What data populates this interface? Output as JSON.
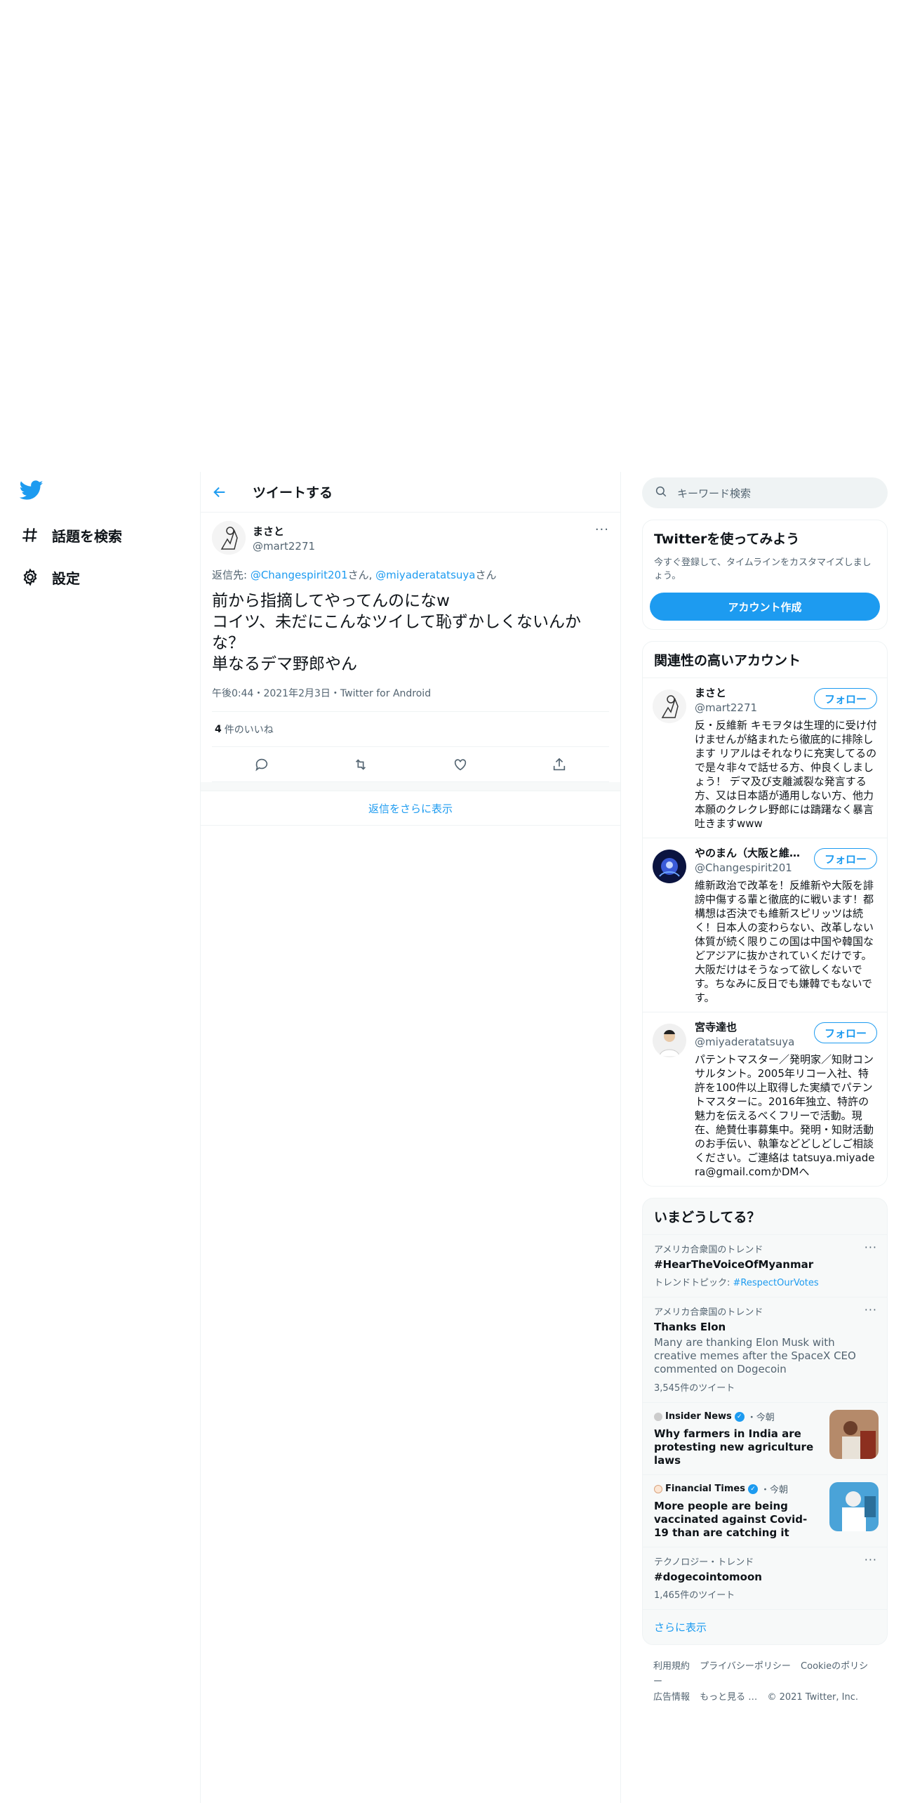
{
  "nav": {
    "explore_label": "話題を検索",
    "settings_label": "設定"
  },
  "header": {
    "title": "ツイートする"
  },
  "tweet": {
    "author_name": "まさと",
    "author_handle": "@mart2271",
    "reply_prefix": "返信先: ",
    "reply_user1": "@Changespirit201",
    "reply_suffix1": "さん, ",
    "reply_user2": "@miyaderatatsuya",
    "reply_suffix2": "さん",
    "text": "前から指摘してやってんのになw\nコイツ、未だにこんなツイして恥ずかしくないんかな？\n単なるデマ野郎やん",
    "meta": "午後0:44・2021年2月3日・Twitter for Android",
    "like_count": "4",
    "like_label": "件のいいね"
  },
  "show_more_replies": "返信をさらに表示",
  "search": {
    "placeholder": "キーワード検索"
  },
  "signup": {
    "title": "Twitterを使ってみよう",
    "subtitle": "今すぐ登録して、タイムラインをカスタマイズしましょう。",
    "button": "アカウント作成"
  },
  "relevant": {
    "title": "関連性の高いアカウント",
    "follow_label": "フォロー",
    "accounts": [
      {
        "name": "まさと",
        "handle": "@mart2271",
        "bio": "反・反維新 キモヲタは生理的に受け付けませんが絡まれたら徹底的に排除します リアルはそれなりに充実してるので是々非々で話せる方、仲良くしましょう！ デマ及び支離滅裂な発言する方、又は日本語が通用しない方、他力本願のクレクレ野郎には躊躇なく暴言吐きますwww"
      },
      {
        "name": "やのまん（大阪と維…",
        "handle": "@Changespirit201",
        "bio": "維新政治で改革を！反維新や大阪を誹謗中傷する輩と徹底的に戦います！都構想は否決でも維新スピリッツは続く！日本人の変わらない、改革しない体質が続く限りこの国は中国や韓国などアジアに抜かされていくだけです。大阪だけはそうなって欲しくないです。ちなみに反日でも嫌韓でもないです。"
      },
      {
        "name": "宮寺達也",
        "handle": "@miyaderatatsuya",
        "bio": "パテントマスター／発明家／知財コンサルタント。2005年リコー入社、特許を100件以上取得した実績でパテントマスターに。2016年独立、特許の魅力を伝えるべくフリーで活動。現在、絶賛仕事募集中。発明・知財活動のお手伝い、執筆などどしどしご相談ください。ご連絡は tatsuya.miyadera@gmail.comかDMへ"
      }
    ]
  },
  "trends": {
    "title": "いまどうしてる？",
    "items": [
      {
        "context": "アメリカ合衆国のトレンド",
        "title": "#HearTheVoiceOfMyanmar",
        "topic_prefix": "トレンドトピック: ",
        "topic_link": "#RespectOurVotes"
      },
      {
        "context": "アメリカ合衆国のトレンド",
        "title": "Thanks Elon",
        "description": "Many are thanking Elon Musk with creative memes after the SpaceX CEO commented on Dogecoin",
        "count": "3,545件のツイート"
      }
    ],
    "news": [
      {
        "source": "Insider News",
        "time": "・今朝",
        "headline": "Why farmers in India are protesting new agriculture laws"
      },
      {
        "source": "Financial Times",
        "time": "・今朝",
        "headline": "More people are being vaccinated against Covid-19 than are catching it"
      }
    ],
    "last": {
      "context": "テクノロジー・トレンド",
      "title": "#dogecointomoon",
      "count": "1,465件のツイート"
    },
    "show_more": "さらに表示"
  },
  "footer": {
    "terms": "利用規約",
    "privacy": "プライバシーポリシー",
    "cookie": "Cookieのポリシー",
    "ads": "広告情報",
    "more": "もっと見る …",
    "copyright": "© 2021 Twitter, Inc."
  },
  "colors": {
    "accent": "#1d9bf0",
    "secondary_text": "#536471",
    "border": "#eff3f4"
  }
}
